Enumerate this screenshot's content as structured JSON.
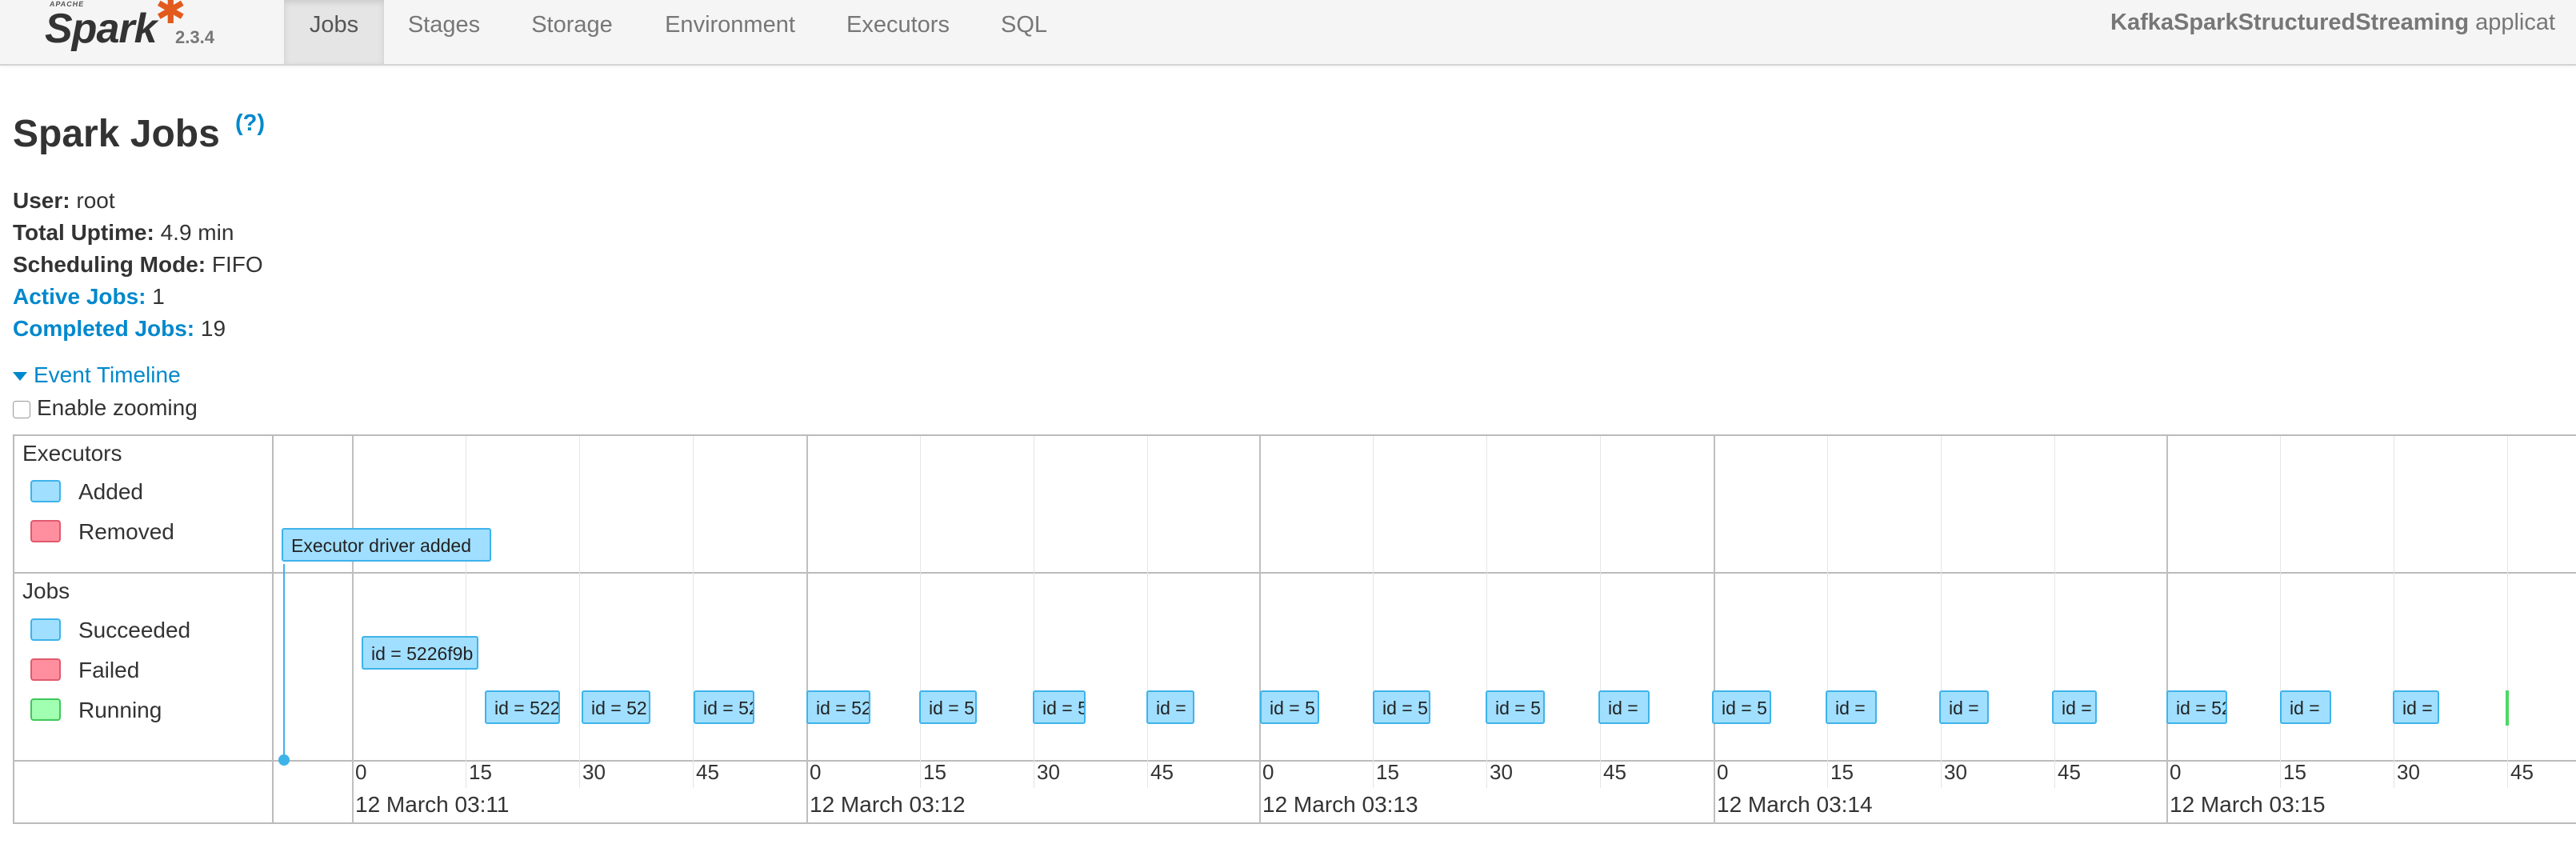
{
  "brand": {
    "apache": "APACHE",
    "name": "Spark",
    "version": "2.3.4"
  },
  "nav": {
    "tabs": [
      "Jobs",
      "Stages",
      "Storage",
      "Environment",
      "Executors",
      "SQL"
    ],
    "active": "Jobs"
  },
  "app": {
    "name_bold": "KafkaSparkStructuredStreaming",
    "suffix": " applicat"
  },
  "page": {
    "title": "Spark Jobs",
    "help": "(?)"
  },
  "summary": {
    "user_label": "User:",
    "user": "root",
    "uptime_label": "Total Uptime:",
    "uptime": "4.9 min",
    "mode_label": "Scheduling Mode:",
    "mode": "FIFO",
    "active_label": "Active Jobs:",
    "active": "1",
    "completed_label": "Completed Jobs:",
    "completed": "19"
  },
  "timeline": {
    "toggle": "Event Timeline",
    "zoom_label": "Enable zooming",
    "executors_group": "Executors",
    "executors_legend": [
      "Added",
      "Removed"
    ],
    "jobs_group": "Jobs",
    "jobs_legend": [
      "Succeeded",
      "Failed",
      "Running"
    ],
    "executor_event": "Executor driver added",
    "job_labels": [
      "id = 5226f9b",
      "id = 522",
      "id = 52",
      "id = 52",
      "id = 52",
      "id = 5",
      "id = 5",
      "id = ",
      "id = 5",
      "id = 5",
      "id = 5",
      "id = ",
      "id = 5",
      "id = ",
      "id = ",
      "id = ",
      "id = 52",
      "id = ",
      "id = "
    ],
    "tick_seconds": [
      "0",
      "15",
      "30",
      "45",
      "0",
      "15",
      "30",
      "45",
      "0",
      "15",
      "30",
      "45",
      "0",
      "15",
      "30",
      "45",
      "0",
      "15",
      "30",
      "45"
    ],
    "minute_labels": [
      "12 March 03:11",
      "12 March 03:12",
      "12 March 03:13",
      "12 March 03:14",
      "12 March 03:15"
    ]
  },
  "colors": {
    "link": "#0088cc",
    "succeeded": "#a0dfff",
    "failed": "#ff8f9f",
    "running": "#a0ffb0",
    "spark_orange": "#e25a1c"
  }
}
